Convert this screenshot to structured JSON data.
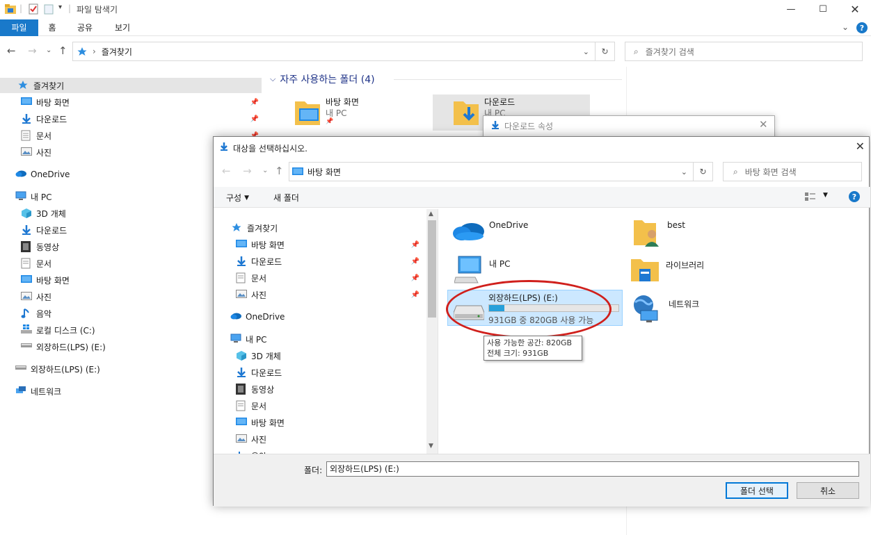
{
  "window": {
    "title": "파일 탐색기",
    "ribbon_tabs": [
      "파일",
      "홈",
      "공유",
      "보기"
    ]
  },
  "address": {
    "path": "즐겨찾기",
    "search_placeholder": "즐겨찾기 검색"
  },
  "nav": {
    "quick_access": "즐겨찾기",
    "quick_items": [
      "바탕 화면",
      "다운로드",
      "문서",
      "사진"
    ],
    "onedrive": "OneDrive",
    "this_pc": "내 PC",
    "pc_items": [
      "3D 개체",
      "다운로드",
      "동영상",
      "문서",
      "바탕 화면",
      "사진",
      "음악",
      "로컬 디스크 (C:)",
      "외장하드(LPS) (E:)"
    ],
    "external_drive": "외장하드(LPS) (E:)",
    "network": "네트워크"
  },
  "content": {
    "frequent_header": "자주 사용하는 폴더 (4)",
    "folders": [
      {
        "name": "바탕 화면",
        "location": "내 PC"
      },
      {
        "name": "다운로드",
        "location": "내 PC"
      }
    ]
  },
  "props_window": {
    "title": "다운로드 속성"
  },
  "dialog": {
    "title": "대상을 선택하십시오.",
    "address": "바탕 화면",
    "search_placeholder": "바탕 화면 검색",
    "organize": "구성",
    "new_folder": "새 폴더",
    "tree": {
      "quick_access": "즐겨찾기",
      "quick_items": [
        "바탕 화면",
        "다운로드",
        "문서",
        "사진"
      ],
      "onedrive": "OneDrive",
      "this_pc": "내 PC",
      "pc_items": [
        "3D 개체",
        "다운로드",
        "동영상",
        "문서",
        "바탕 화면",
        "사진",
        "음악"
      ]
    },
    "tiles": {
      "onedrive": "OneDrive",
      "best": "best",
      "this_pc": "내 PC",
      "library": "라이브러리",
      "drive_name": "외장하드(LPS) (E:)",
      "drive_free": "931GB 중 820GB 사용 가능",
      "drive_used_fraction": 0.12,
      "network": "네트워크"
    },
    "tooltip": {
      "line1": "사용 가능한 공간: 820GB",
      "line2": "전체 크기: 931GB"
    },
    "folder_label": "폴더:",
    "folder_value": "외장하드(LPS) (E:)",
    "select_button": "폴더 선택",
    "cancel_button": "취소"
  },
  "colors": {
    "accent": "#1979ca",
    "selection": "#cce8ff",
    "annotation": "#d0201c"
  }
}
